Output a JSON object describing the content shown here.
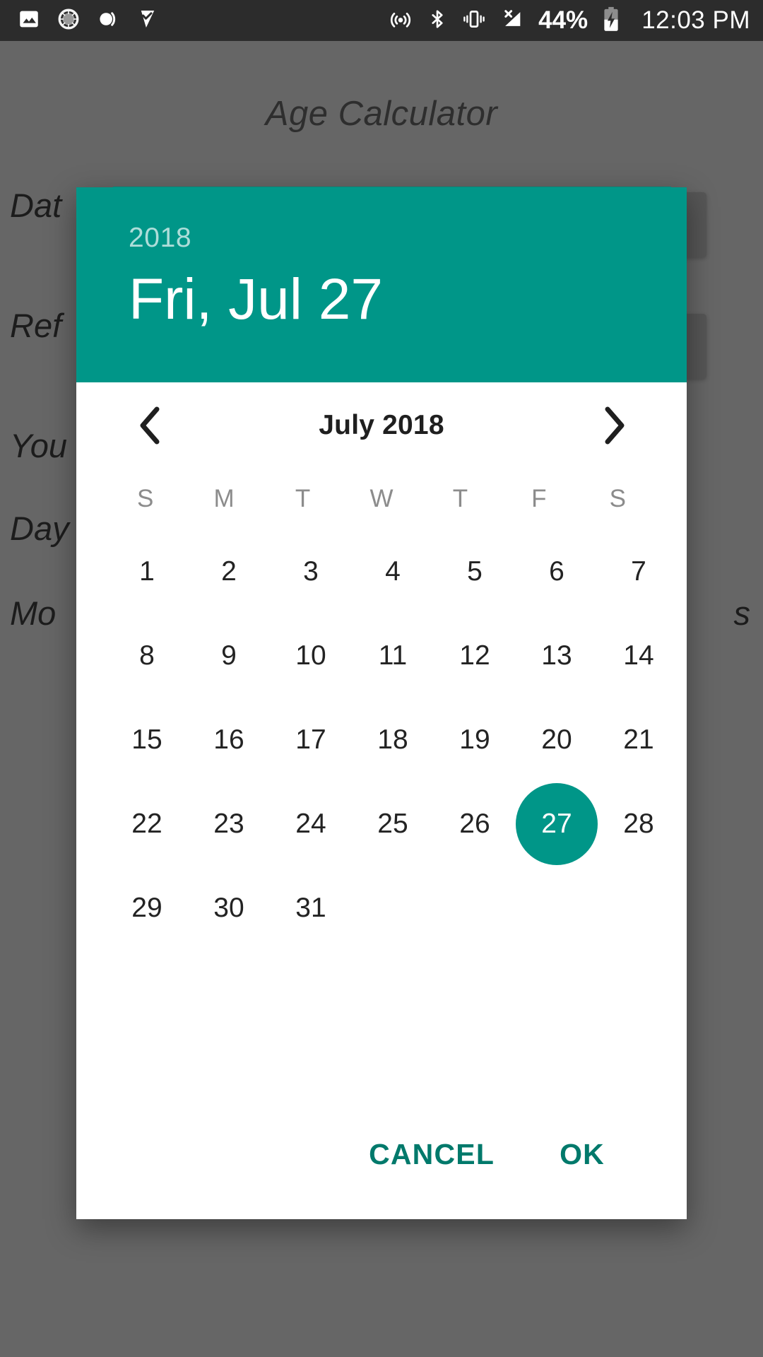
{
  "status_bar": {
    "background_color": "#2c2c2c",
    "time": "12:03 PM",
    "battery_percent": "44%",
    "left_icons": [
      "image-icon",
      "sync-spinner-icon",
      "do-not-disturb-icon",
      "checkmark-flag-icon"
    ],
    "right_icons": [
      "hotspot-icon",
      "bluetooth-icon",
      "vibrate-icon",
      "no-signal-icon",
      "battery-charging-icon"
    ]
  },
  "background_app": {
    "title": "Age Calculator",
    "accent_color": "#009688",
    "scrim_color": "#666666",
    "rows": [
      {
        "text": "Date of Birth",
        "visible_fragment": "Dat"
      },
      {
        "text": "Reference Date",
        "visible_fragment": "Ref"
      },
      {
        "text": "Your Age",
        "visible_fragment": "You"
      },
      {
        "text": "Days",
        "visible_fragment": "Day"
      },
      {
        "text": "Months",
        "visible_fragment": "Mo"
      }
    ],
    "right_fragment": "s"
  },
  "dialog": {
    "accent_color": "#009688",
    "header": {
      "year": "2018",
      "date": "Fri, Jul 27"
    },
    "calendar": {
      "month_label": "July 2018",
      "prev_icon": "chevron-left-icon",
      "next_icon": "chevron-right-icon",
      "weekdays": [
        "S",
        "M",
        "T",
        "W",
        "T",
        "F",
        "S"
      ],
      "leading_blanks": 0,
      "days": [
        1,
        2,
        3,
        4,
        5,
        6,
        7,
        8,
        9,
        10,
        11,
        12,
        13,
        14,
        15,
        16,
        17,
        18,
        19,
        20,
        21,
        22,
        23,
        24,
        25,
        26,
        27,
        28,
        29,
        30,
        31
      ],
      "selected_day": 27
    },
    "buttons": {
      "cancel_label": "CANCEL",
      "ok_label": "OK"
    }
  }
}
